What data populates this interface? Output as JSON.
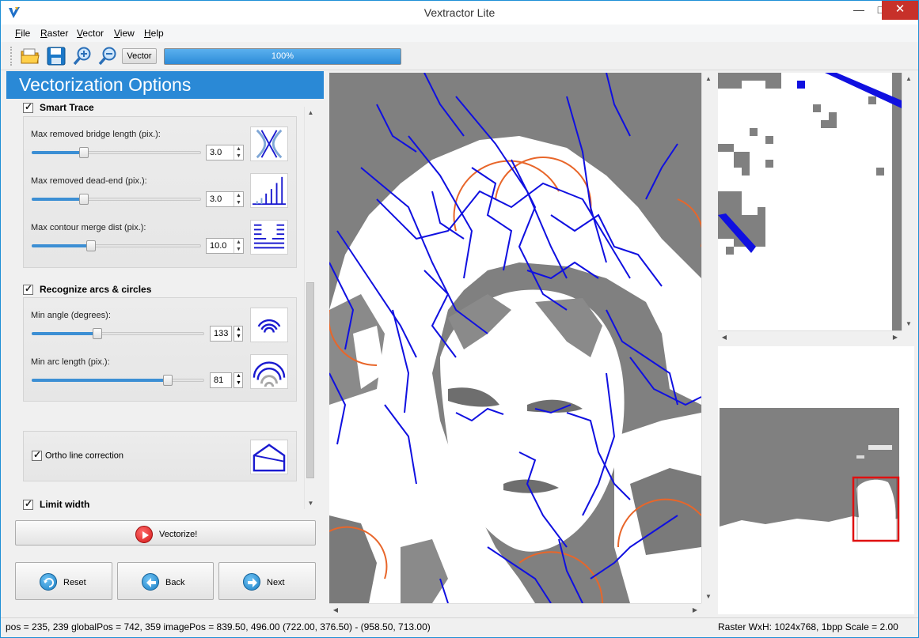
{
  "window": {
    "title": "Vextractor Lite",
    "min_icon": "minimize-icon",
    "max_icon": "maximize-icon",
    "close_icon": "close-icon"
  },
  "menu": [
    {
      "label_ul": "F",
      "label_rest": "ile"
    },
    {
      "label_ul": "R",
      "label_rest": "aster"
    },
    {
      "label_ul": "V",
      "label_rest": "ector"
    },
    {
      "label_ul": "V",
      "label_rest": "iew"
    },
    {
      "label_ul": "H",
      "label_rest": "elp"
    }
  ],
  "toolbar": {
    "icons": [
      "open-folder-icon",
      "save-icon",
      "zoom-in-icon",
      "zoom-out-icon"
    ],
    "vector_button": "Vector",
    "progress_text": "100%",
    "progress_value": 1.0
  },
  "panel": {
    "title": "Vectorization Options",
    "smart_trace": {
      "label": "Smart Trace",
      "checked": true,
      "options": [
        {
          "label": "Max removed bridge length (pix.):",
          "value": "3.0",
          "fraction": 0.3,
          "icon": "bridge-icon"
        },
        {
          "label": "Max removed dead-end (pix.):",
          "value": "3.0",
          "fraction": 0.3,
          "icon": "dead-end-icon"
        },
        {
          "label": "Max contour merge dist (pix.):",
          "value": "10.0",
          "fraction": 0.34,
          "icon": "contour-merge-icon"
        }
      ]
    },
    "arcs": {
      "label": "Recognize arcs & circles",
      "checked": true,
      "options": [
        {
          "label": "Min angle (degrees):",
          "value": "133",
          "fraction": 0.37,
          "icon": "arc-angle-icon"
        },
        {
          "label": "Min arc length (pix.):",
          "value": "81",
          "fraction": 0.79,
          "icon": "arc-length-icon"
        }
      ]
    },
    "ortho": {
      "label": "Ortho line correction",
      "checked": true,
      "icon": "ortho-house-icon"
    },
    "limit_width": {
      "label": "Limit width",
      "checked": true
    },
    "vectorize_button": "Vectorize!",
    "reset_button": "Reset",
    "back_button": "Back",
    "next_button": "Next"
  },
  "status": {
    "left": "pos = 235, 239  globalPos = 742, 359  imagePos = 839.50, 496.00  (722.00, 376.50) - (958.50, 713.00)",
    "right": "Raster WxH: 1024x768, 1bpp  Scale = 2.00"
  },
  "colors": {
    "accent": "#2a89d6",
    "vector_lines": "#1010e0",
    "arcs": "#e8662a",
    "raster_gray": "#808080",
    "viewport_box": "#e01010"
  }
}
